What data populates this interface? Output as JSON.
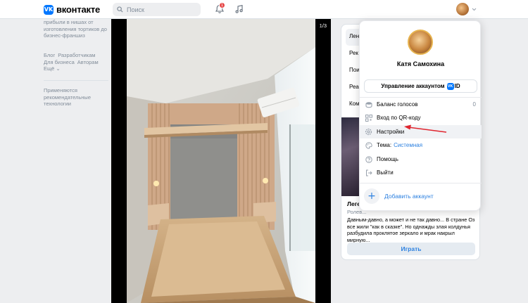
{
  "header": {
    "logo_mark": "VK",
    "logo_text": "вконтакте",
    "search_placeholder": "Поиск",
    "notifications_count": "1"
  },
  "left": {
    "promo": "прибыли в нишах от изготовления тортиков до бизнес-франшиз",
    "links": [
      "Блог",
      "Разработчикам",
      "Для бизнеса",
      "Авторам",
      "Ещё ⌄"
    ],
    "recs": "Применяются рекомендательные технологии"
  },
  "viewer": {
    "counter": "1/3"
  },
  "right": {
    "tabs": [
      "Лен",
      "Рек",
      "Пои",
      "Реа",
      "Ком"
    ],
    "card_title": "Леге",
    "card_subtitle": "Ролев...",
    "card_desc": "Давным-давно, а может и не так давно... В стране Оз все жили \"как в сказке\". Но однажды злая колдунья разбудила проклятое зеркало и мрак накрыл мирную...",
    "play_label": "Играть"
  },
  "dropdown": {
    "name": "Катя Самохина",
    "manage_label": "Управление аккаунтом",
    "id_mark": "VK",
    "id_text": "ID",
    "items": [
      {
        "label": "Баланс голосов",
        "value": "0",
        "icon": "coins-icon"
      },
      {
        "label": "Вход по QR-коду",
        "icon": "qr-icon"
      },
      {
        "label": "Настройки",
        "icon": "gear-icon"
      },
      {
        "label": "Тема:",
        "value": "Системная",
        "icon": "palette-icon"
      },
      {
        "label": "Помощь",
        "icon": "help-icon"
      },
      {
        "label": "Выйти",
        "icon": "logout-icon"
      }
    ],
    "add_label": "Добавить аккаунт"
  },
  "colors": {
    "accent": "#2d81e0",
    "brand": "#0077ff",
    "annotation_arrow": "#e0262f"
  }
}
